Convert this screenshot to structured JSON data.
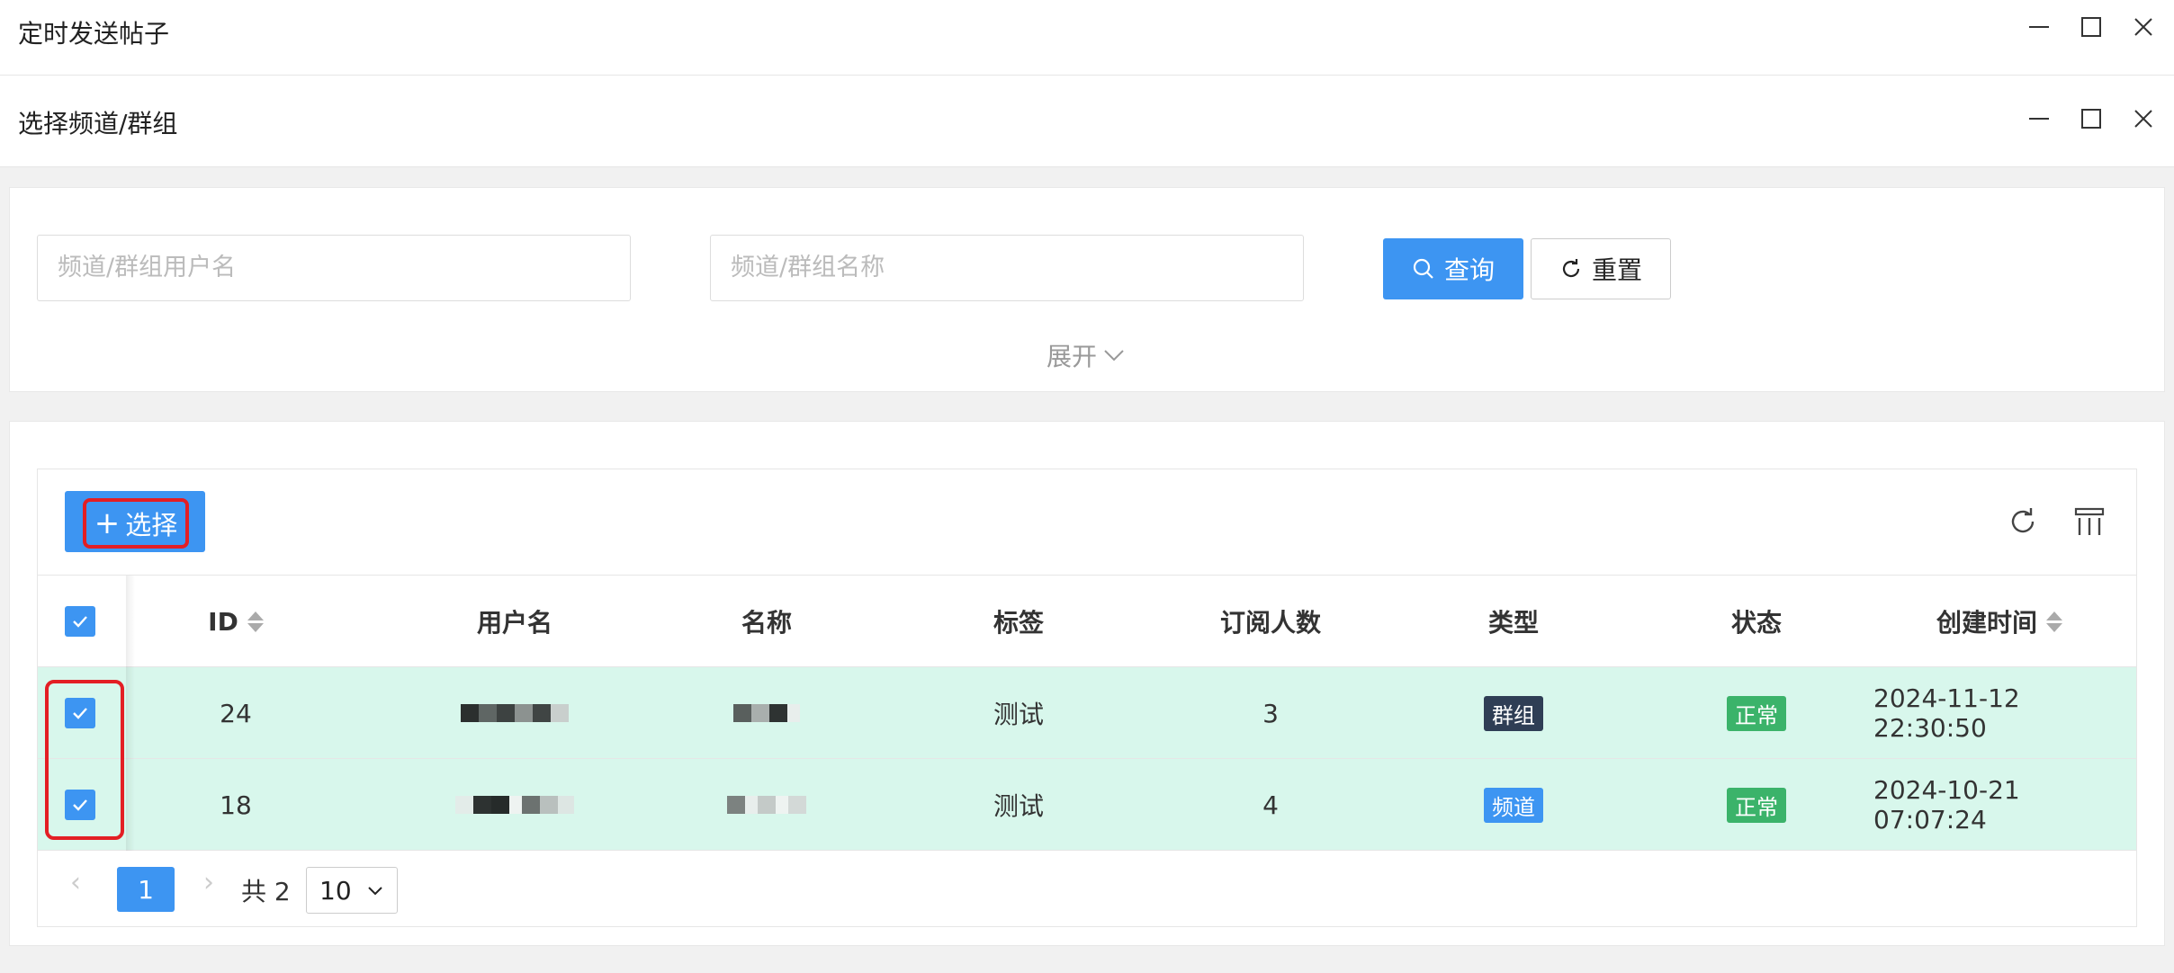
{
  "windows": {
    "outer_title": "定时发送帖子",
    "inner_title": "选择频道/群组"
  },
  "search": {
    "username_placeholder": "频道/群组用户名",
    "name_placeholder": "频道/群组名称",
    "query_label": "查询",
    "reset_label": "重置",
    "expand_label": "展开"
  },
  "toolbar": {
    "select_label": "选择"
  },
  "table": {
    "columns": {
      "id": "ID",
      "username": "用户名",
      "name": "名称",
      "tag": "标签",
      "subscribers": "订阅人数",
      "type": "类型",
      "status": "状态",
      "created": "创建时间"
    },
    "rows": [
      {
        "id": "24",
        "tag": "测试",
        "subscribers": "3",
        "type": "群组",
        "status": "正常",
        "created": "2024-11-12 22:30:50"
      },
      {
        "id": "18",
        "tag": "测试",
        "subscribers": "4",
        "type": "频道",
        "status": "正常",
        "created": "2024-10-21 07:07:24"
      }
    ]
  },
  "pagination": {
    "prev": "‹",
    "next": "›",
    "current_page": "1",
    "total": "共 2",
    "page_size": "10"
  },
  "colors": {
    "primary": "#3d95f2",
    "row_selected": "#d8f7ec",
    "tag_group": "#2f3e55",
    "tag_ok": "#3bb36a",
    "highlight": "#e31e24"
  }
}
